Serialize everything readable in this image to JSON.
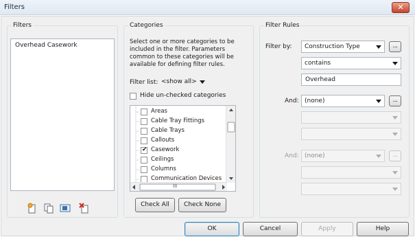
{
  "window": {
    "title": "Filters",
    "close_label": "✕"
  },
  "filters_panel": {
    "label": "Filters",
    "items": [
      "Overhead Casework"
    ]
  },
  "categories_panel": {
    "label": "Categories",
    "description": "Select one or more categories to be included in the filter.  Parameters common to these categories will be available for defining filter rules.",
    "filter_list_label": "Filter list:",
    "filter_list_value": "<show all>",
    "hide_unchecked_label": "Hide un-checked categories",
    "tree": [
      {
        "label": "Areas",
        "checked": false
      },
      {
        "label": "Cable Tray Fittings",
        "checked": false
      },
      {
        "label": "Cable Trays",
        "checked": false
      },
      {
        "label": "Callouts",
        "checked": false
      },
      {
        "label": "Casework",
        "checked": true
      },
      {
        "label": "Ceilings",
        "checked": false
      },
      {
        "label": "Columns",
        "checked": false
      },
      {
        "label": "Communication Devices",
        "checked": false
      }
    ],
    "hscroll_label": "III",
    "check_all_label": "Check All",
    "check_none_label": "Check None"
  },
  "rules_panel": {
    "label": "Filter Rules",
    "filter_by_label": "Filter by:",
    "filter_by_value": "Construction Type",
    "operator_value": "contains",
    "value_text": "Overhead",
    "and1_label": "And:",
    "and1_value": "(none)",
    "and2_label": "And:",
    "and2_value": "(none)",
    "ellipsis_label": "..."
  },
  "footer": {
    "ok_label": "OK",
    "cancel_label": "Cancel",
    "apply_label": "Apply",
    "help_label": "Help"
  }
}
